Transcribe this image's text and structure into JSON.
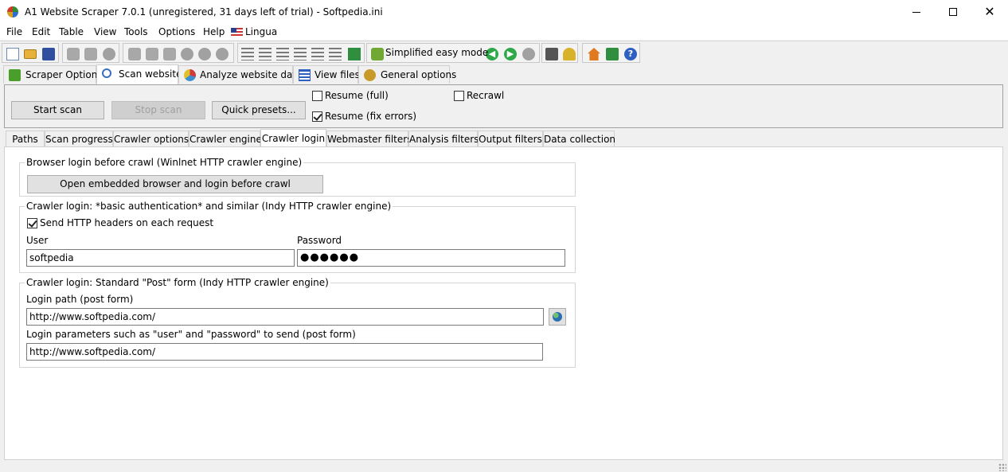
{
  "window": {
    "title": "A1 Website Scraper 7.0.1 (unregistered, 31 days left of trial) - Softpedia.ini",
    "minimize": "minimize",
    "maximize": "maximize",
    "close": "close"
  },
  "menu": [
    "File",
    "Edit",
    "Table",
    "View",
    "Tools",
    "Options",
    "Help",
    "Lingua"
  ],
  "toolbar": {
    "simplified_label": "Simplified easy mode"
  },
  "main_tabs": [
    "Scraper Options",
    "Scan website",
    "Analyze website data",
    "View files",
    "General options"
  ],
  "scan_panel": {
    "start_scan": "Start scan",
    "stop_scan": "Stop scan",
    "quick_presets": "Quick presets...",
    "resume_full": "Resume (full)",
    "resume_fix": "Resume (fix errors)",
    "recrawl": "Recrawl",
    "resume_full_checked": false,
    "resume_fix_checked": true,
    "recrawl_checked": false
  },
  "sub_tabs": [
    "Paths",
    "Scan progress",
    "Crawler options",
    "Crawler engine",
    "Crawler login",
    "Webmaster filters",
    "Analysis filters",
    "Output filters",
    "Data collection"
  ],
  "browser_login": {
    "title": "Browser login before crawl (Winlnet HTTP crawler engine)",
    "button": "Open embedded browser and login before crawl"
  },
  "basic_auth": {
    "title": "Crawler login: *basic authentication* and similar (Indy HTTP crawler engine)",
    "send_headers": "Send HTTP headers on each request",
    "send_headers_checked": true,
    "user_label": "User",
    "user_value": "softpedia",
    "password_label": "Password",
    "password_value": "●●●●●●"
  },
  "post_form": {
    "title": "Crawler login: Standard \"Post\" form (Indy HTTP crawler engine)",
    "login_path_label": "Login path (post form)",
    "login_path_value": "http://www.softpedia.com/",
    "params_label": "Login parameters such as \"user\" and \"password\" to send (post form)",
    "params_value": "http://www.softpedia.com/"
  }
}
